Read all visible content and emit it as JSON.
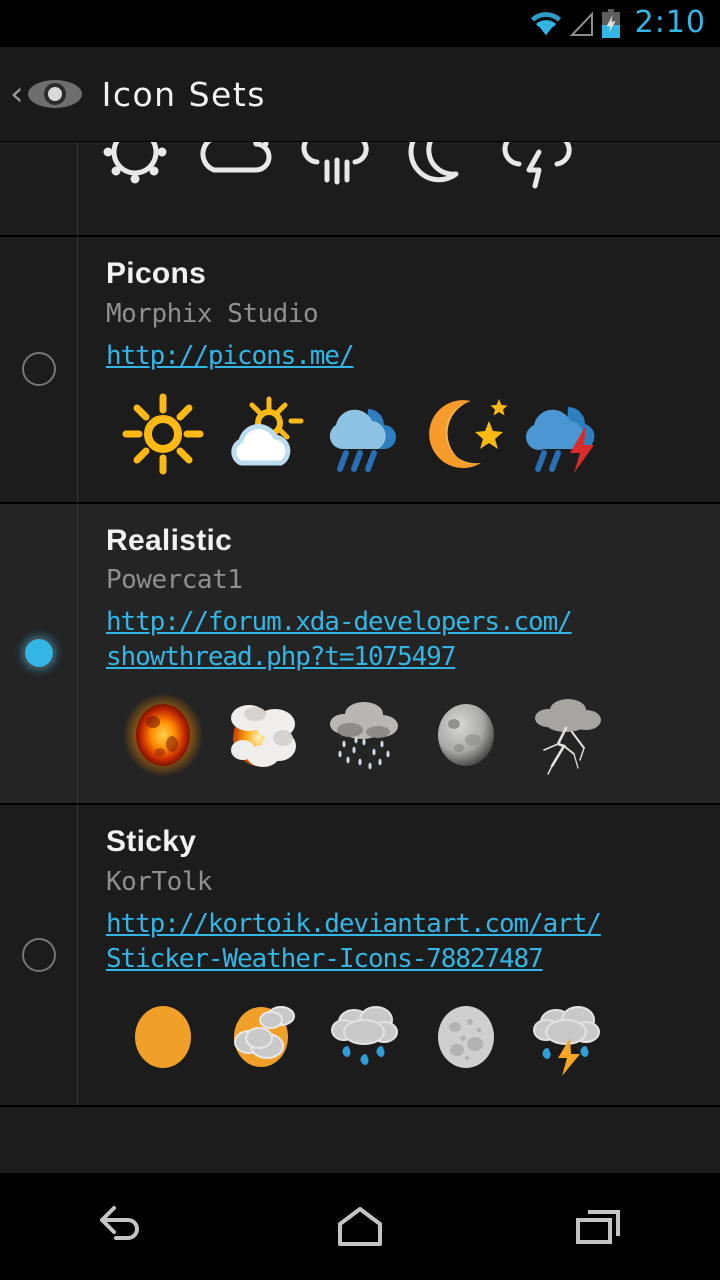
{
  "status_bar": {
    "time": "2:10",
    "icons": [
      "wifi-icon",
      "cellular-signal-icon",
      "battery-charging-icon"
    ],
    "accent_color": "#33b5e5"
  },
  "action_bar": {
    "back_glyph": "‹",
    "app_icon": "eye-icon",
    "title": "Icon Sets"
  },
  "list": {
    "rows": [
      {
        "name": "clipped-row",
        "title": "",
        "author": "",
        "url_lines": [],
        "selected": false,
        "icon_style": "outline",
        "icons": [
          "sun-icon",
          "cloud-icon",
          "rain-icon",
          "moon-icon",
          "thunderstorm-icon"
        ]
      },
      {
        "name": "picons",
        "title": "Picons",
        "author": "Morphix Studio",
        "url_lines": [
          "http://picons.me/"
        ],
        "selected": false,
        "icon_style": "picons",
        "icons": [
          "sun-icon",
          "partly-cloudy-icon",
          "rain-icon",
          "moon-star-icon",
          "thunderstorm-icon"
        ]
      },
      {
        "name": "realistic",
        "title": "Realistic",
        "author": "Powercat1",
        "url_lines": [
          "http://forum.xda-developers.com/",
          "showthread.php?t=1075497"
        ],
        "selected": true,
        "icon_style": "realistic",
        "icons": [
          "sun-icon",
          "sun-cloud-icon",
          "rain-icon",
          "moon-icon",
          "lightning-icon"
        ]
      },
      {
        "name": "sticky",
        "title": "Sticky",
        "author": "KorTolk",
        "url_lines": [
          "http://kortoik.deviantart.com/art/",
          "Sticker-Weather-Icons-78827487"
        ],
        "selected": false,
        "icon_style": "sticky",
        "icons": [
          "sun-icon",
          "partly-cloudy-icon",
          "rain-icon",
          "moon-icon",
          "thunderstorm-icon"
        ]
      }
    ]
  },
  "nav_bar": {
    "buttons": [
      "back-nav-icon",
      "home-nav-icon",
      "recents-nav-icon"
    ]
  },
  "colors": {
    "accent": "#33b5e5",
    "background": "#1c1c1c",
    "selected_row": "#242424",
    "title_text": "#f2f2f2",
    "author_text": "#8f8f8f"
  }
}
